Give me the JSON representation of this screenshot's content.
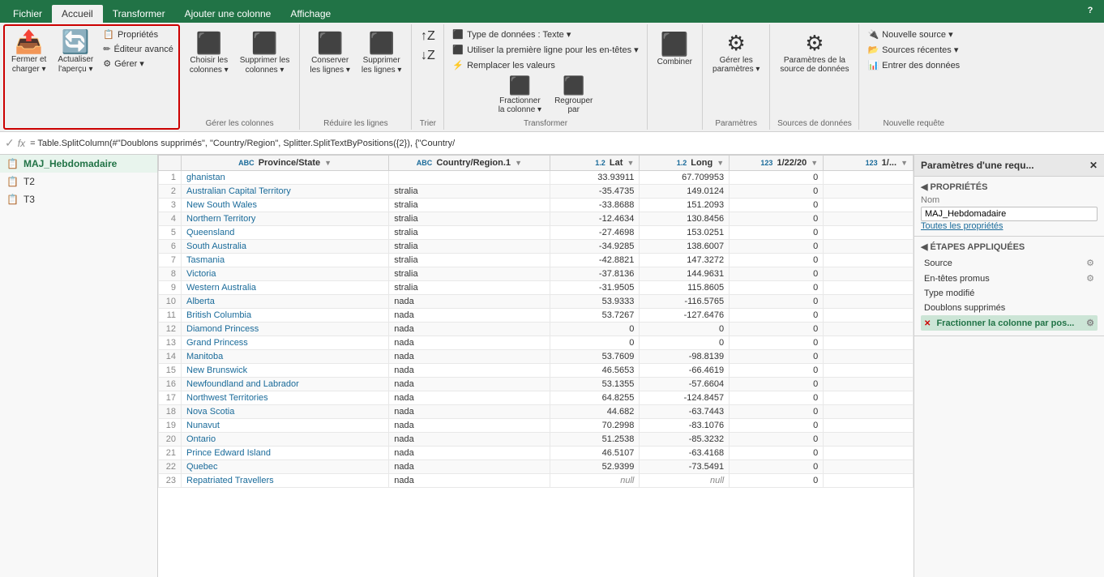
{
  "ribbon": {
    "tabs": [
      "Fichier",
      "Accueil",
      "Transformer",
      "Ajouter une colonne",
      "Affichage"
    ],
    "active_tab": "Accueil",
    "groups": {
      "fermer": {
        "label": "Fermer et charger",
        "btns_large": [
          {
            "id": "fermer-charger",
            "icon": "⬆",
            "label": "Fermer et\ncharger ▾"
          },
          {
            "id": "actualiser",
            "icon": "🔄",
            "label": "Actualiser\nl'aperçu ▾"
          }
        ],
        "btns_small": [
          {
            "id": "proprietes",
            "icon": "📋",
            "label": "Propriétés"
          },
          {
            "id": "editeur",
            "icon": "✏",
            "label": "Éditeur avancé"
          },
          {
            "id": "gerer",
            "icon": "⚙",
            "label": "Gérer ▾"
          }
        ]
      },
      "colonnes": {
        "label": "Gérer les colonnes",
        "btns": [
          {
            "id": "choisir",
            "icon": "☰",
            "label": "Choisir les\ncolonnes ▾"
          },
          {
            "id": "supprimer",
            "icon": "✖",
            "label": "Supprimer les\ncolonnes ▾"
          }
        ]
      },
      "lignes": {
        "label": "Réduire les lignes",
        "btns": [
          {
            "id": "conserver",
            "icon": "≡",
            "label": "Conserver\nles lignes ▾"
          },
          {
            "id": "supprimer-lignes",
            "icon": "≢",
            "label": "Supprimer\nles lignes ▾"
          }
        ]
      },
      "trier": {
        "label": "Trier",
        "btns": [
          {
            "id": "az",
            "icon": "↕",
            "label": ""
          },
          {
            "id": "za",
            "icon": "↕",
            "label": ""
          }
        ]
      },
      "transformer": {
        "label": "Transformer",
        "items": [
          {
            "id": "type-donnees",
            "label": "Type de données : Texte ▾"
          },
          {
            "id": "utiliser-premiere",
            "label": "Utiliser la première ligne pour les en-têtes ▾"
          },
          {
            "id": "remplacer",
            "label": "⚡ Remplacer les valeurs"
          },
          {
            "id": "fractionner",
            "icon": "⬛",
            "label": "Fractionner\nla colonne ▾"
          },
          {
            "id": "regrouper",
            "icon": "⬛",
            "label": "Regrouper\npar"
          }
        ]
      },
      "combiner": {
        "label": "",
        "btns": [
          {
            "id": "combiner",
            "icon": "⬛",
            "label": "Combiner"
          }
        ]
      },
      "parametres-groupe": {
        "label": "Paramètres",
        "btns": [
          {
            "id": "gerer-params",
            "icon": "⚙",
            "label": "Gérer les\nparamètres ▾"
          }
        ]
      },
      "sources-donnees": {
        "label": "Sources de données",
        "btns": [
          {
            "id": "params-source",
            "icon": "⚙",
            "label": "Paramètres de la\nsource de données"
          }
        ]
      },
      "nouvelle-requete": {
        "label": "Nouvelle requête",
        "btns": [
          {
            "id": "nouvelle-source",
            "label": "🔌 Nouvelle source ▾"
          },
          {
            "id": "sources-recentes",
            "label": "📂 Sources récentes ▾"
          },
          {
            "id": "entrer-donnees",
            "label": "📊 Entrer des données"
          }
        ]
      }
    },
    "formula": "= Table.SplitColumn(#\"Doublons supprimés\", \"Country/Region\", Splitter.SplitTextByPositions({2}), {\"Country/"
  },
  "sidebar": {
    "items": [
      {
        "id": "maj",
        "label": "MAJ_Hebdomadaire",
        "active": true
      },
      {
        "id": "t2",
        "label": "T2",
        "active": false
      },
      {
        "id": "t3",
        "label": "T3",
        "active": false
      }
    ]
  },
  "table": {
    "columns": [
      {
        "id": "row-num",
        "label": "",
        "type": ""
      },
      {
        "id": "province",
        "label": "Province/State",
        "type": "ABC"
      },
      {
        "id": "country",
        "label": "Country/Region.1",
        "type": "ABC"
      },
      {
        "id": "lat",
        "label": "Lat",
        "type": "1.2"
      },
      {
        "id": "long",
        "label": "Long",
        "type": "1.2"
      },
      {
        "id": "date1",
        "label": "1/22/20",
        "type": "123"
      },
      {
        "id": "date2",
        "label": "1/...",
        "type": "123"
      }
    ],
    "rows": [
      {
        "num": 1,
        "province": "ghanistan",
        "country": "",
        "lat": "33.93911",
        "long": "67.709953",
        "d1": "0",
        "highlighted": false
      },
      {
        "num": 2,
        "province": "Australian Capital Territory",
        "country": "stralia",
        "lat": "-35.4735",
        "long": "149.0124",
        "d1": "0",
        "highlighted": false
      },
      {
        "num": 3,
        "province": "New South Wales",
        "country": "stralia",
        "lat": "-33.8688",
        "long": "151.2093",
        "d1": "0",
        "highlighted": false
      },
      {
        "num": 4,
        "province": "Northern Territory",
        "country": "stralia",
        "lat": "-12.4634",
        "long": "130.8456",
        "d1": "0",
        "highlighted": false
      },
      {
        "num": 5,
        "province": "Queensland",
        "country": "stralia",
        "lat": "-27.4698",
        "long": "153.0251",
        "d1": "0",
        "highlighted": false
      },
      {
        "num": 6,
        "province": "South Australia",
        "country": "stralia",
        "lat": "-34.9285",
        "long": "138.6007",
        "d1": "0",
        "highlighted": false
      },
      {
        "num": 7,
        "province": "Tasmania",
        "country": "stralia",
        "lat": "-42.8821",
        "long": "147.3272",
        "d1": "0",
        "highlighted": false
      },
      {
        "num": 8,
        "province": "Victoria",
        "country": "stralia",
        "lat": "-37.8136",
        "long": "144.9631",
        "d1": "0",
        "highlighted": false
      },
      {
        "num": 9,
        "province": "Western Australia",
        "country": "stralia",
        "lat": "-31.9505",
        "long": "115.8605",
        "d1": "0",
        "highlighted": false
      },
      {
        "num": 10,
        "province": "Alberta",
        "country": "nada",
        "lat": "53.9333",
        "long": "-116.5765",
        "d1": "0",
        "highlighted": false
      },
      {
        "num": 11,
        "province": "British Columbia",
        "country": "nada",
        "lat": "53.7267",
        "long": "-127.6476",
        "d1": "0",
        "highlighted": false
      },
      {
        "num": 12,
        "province": "Diamond Princess",
        "country": "nada",
        "lat": "0",
        "long": "0",
        "d1": "0",
        "highlighted": false
      },
      {
        "num": 13,
        "province": "Grand Princess",
        "country": "nada",
        "lat": "0",
        "long": "0",
        "d1": "0",
        "highlighted": false
      },
      {
        "num": 14,
        "province": "Manitoba",
        "country": "nada",
        "lat": "53.7609",
        "long": "-98.8139",
        "d1": "0",
        "highlighted": false
      },
      {
        "num": 15,
        "province": "New Brunswick",
        "country": "nada",
        "lat": "46.5653",
        "long": "-66.4619",
        "d1": "0",
        "highlighted": false
      },
      {
        "num": 16,
        "province": "Newfoundland and Labrador",
        "country": "nada",
        "lat": "53.1355",
        "long": "-57.6604",
        "d1": "0",
        "highlighted": false
      },
      {
        "num": 17,
        "province": "Northwest Territories",
        "country": "nada",
        "lat": "64.8255",
        "long": "-124.8457",
        "d1": "0",
        "highlighted": false
      },
      {
        "num": 18,
        "province": "Nova Scotia",
        "country": "nada",
        "lat": "44.682",
        "long": "-63.7443",
        "d1": "0",
        "highlighted": false
      },
      {
        "num": 19,
        "province": "Nunavut",
        "country": "nada",
        "lat": "70.2998",
        "long": "-83.1076",
        "d1": "0",
        "highlighted": false
      },
      {
        "num": 20,
        "province": "Ontario",
        "country": "nada",
        "lat": "51.2538",
        "long": "-85.3232",
        "d1": "0",
        "highlighted": false
      },
      {
        "num": 21,
        "province": "Prince Edward Island",
        "country": "nada",
        "lat": "46.5107",
        "long": "-63.4168",
        "d1": "0",
        "highlighted": false
      },
      {
        "num": 22,
        "province": "Quebec",
        "country": "nada",
        "lat": "52.9399",
        "long": "-73.5491",
        "d1": "0",
        "highlighted": false
      },
      {
        "num": 23,
        "province": "Repatriated Travellers",
        "country": "nada",
        "lat": "null",
        "long": "null",
        "d1": "0",
        "highlighted": false
      }
    ]
  },
  "props_panel": {
    "title": "Paramètres d'une requ...",
    "close_label": "✕",
    "sections": {
      "proprietes": {
        "title": "PROPRIÉTÉS",
        "nom_label": "Nom",
        "nom_value": "MAJ_Hebdomadaire",
        "toutes_props": "Toutes les propriétés"
      },
      "etapes": {
        "title": "ÉTAPES APPLIQUÉES",
        "steps": [
          {
            "id": "source",
            "label": "Source",
            "active": false,
            "has_gear": true,
            "has_error": false
          },
          {
            "id": "entetes",
            "label": "En-têtes promus",
            "active": false,
            "has_gear": true,
            "has_error": false
          },
          {
            "id": "type-modifie",
            "label": "Type modifié",
            "active": false,
            "has_gear": false,
            "has_error": false
          },
          {
            "id": "doublons",
            "label": "Doublons supprimés",
            "active": false,
            "has_gear": false,
            "has_error": false
          },
          {
            "id": "fractionner-col",
            "label": "Fractionner la colonne par pos...",
            "active": true,
            "has_gear": true,
            "has_error": true
          }
        ]
      }
    }
  },
  "help_icon": "?",
  "formula_check": "✓",
  "formula_fx": "fx"
}
